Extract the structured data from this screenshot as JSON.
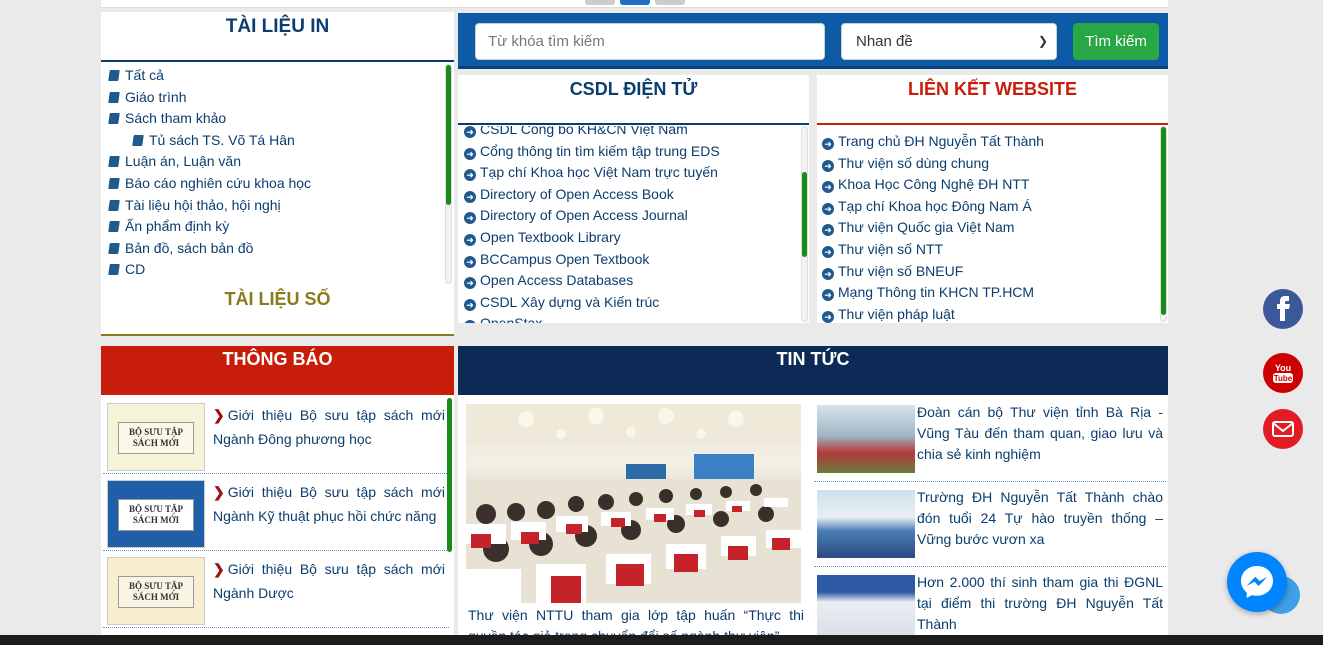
{
  "tai_lieu_in": {
    "title": "TÀI LIỆU IN",
    "items": [
      {
        "label": "Tất cả",
        "indent": false
      },
      {
        "label": "Giáo trình",
        "indent": false
      },
      {
        "label": "Sách tham khảo",
        "indent": false
      },
      {
        "label": "Tủ sách TS. Võ Tá Hân",
        "indent": true
      },
      {
        "label": "Luận án, Luận văn",
        "indent": false
      },
      {
        "label": "Báo cáo nghiên cứu khoa học",
        "indent": false
      },
      {
        "label": "Tài liệu hội thảo, hội nghị",
        "indent": false
      },
      {
        "label": "Ấn phẩm định kỳ",
        "indent": false
      },
      {
        "label": "Bản đồ, sách bản đồ",
        "indent": false
      },
      {
        "label": "CD",
        "indent": false
      }
    ],
    "tai_lieu_so_title": "TÀI LIỆU SỐ"
  },
  "search": {
    "placeholder": "Từ khóa tìm kiếm",
    "select_value": "Nhan đề",
    "button_label": "Tìm kiếm"
  },
  "csdl": {
    "title": "CSDL ĐIỆN TỬ",
    "items": [
      "CSDL Công bố KH&CN Việt Nam",
      "Cổng thông tin tìm kiếm tập trung EDS",
      "Tạp chí Khoa học Việt Nam trực tuyến",
      "Directory of Open Access Book",
      "Directory of Open Access Journal",
      "Open Textbook Library",
      "BCCampus Open Textbook",
      "Open Access Databases",
      "CSDL Xây dựng và Kiến trúc",
      "OpenStax"
    ]
  },
  "lien_ket": {
    "title": "LIÊN KẾT WEBSITE",
    "items": [
      "Trang chủ ĐH Nguyễn Tất Thành",
      "Thư viện số dùng chung",
      "Khoa Học Công Nghệ ĐH NTT",
      "Tạp chí Khoa học Đông Nam Á",
      "Thư viện Quốc gia Việt Nam",
      "Thư viện số NTT",
      "Thư viện số BNEUF",
      "Mạng Thông tin KHCN TP.HCM",
      "Thư viện pháp luật"
    ]
  },
  "thong_bao": {
    "title": "THÔNG BÁO",
    "items": [
      {
        "text": "Giới thiệu Bộ sưu tập sách mới Ngành Đông phương học",
        "thumb": "BỘ SƯU TẬP SÁCH MỚI"
      },
      {
        "text": "Giới thiệu Bộ sưu tập sách mới Ngành Kỹ thuật phục hồi chức năng",
        "thumb": "BỘ SƯU TẬP SÁCH MỚI"
      },
      {
        "text": "Giới thiệu Bộ sưu tập sách mới Ngành Dược",
        "thumb": "BỘ SƯU TẬP SÁCH MỚI"
      }
    ]
  },
  "tin_tuc": {
    "title": "TIN TỨC",
    "featured_caption": "Thư viện NTTU tham gia lớp tập huấn “Thực thi quyền tác giả trong chuyển đổi số ngành thư viện”",
    "items": [
      "Đoàn cán bộ Thư viện tỉnh Bà Rịa - Vũng Tàu đến tham quan, giao lưu và chia sẻ kinh nghiệm",
      "Trường ĐH Nguyễn Tất Thành chào đón tuổi 24 Tự hào truyền thống – Vững bước vươn xa",
      "Hơn 2.000 thí sinh tham gia thi ĐGNL tại điểm thi trường ĐH Nguyễn Tất Thành"
    ]
  },
  "colors": {
    "navy": "#0c2a55",
    "red": "#c91d0b",
    "green": "#28a745",
    "blue": "#0d5aa7"
  },
  "social": [
    "facebook-icon",
    "youtube-icon",
    "mail-icon",
    "messenger-icon"
  ]
}
